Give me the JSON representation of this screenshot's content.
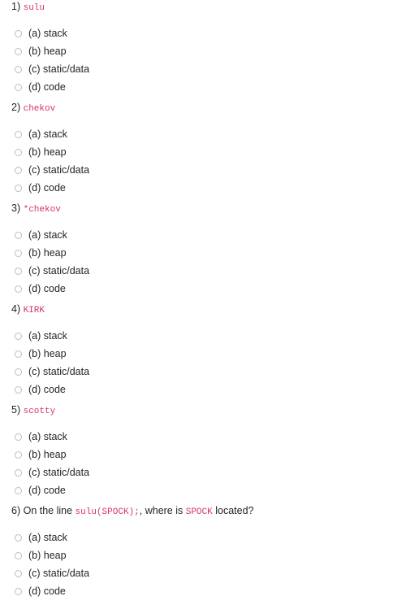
{
  "form": {
    "questions": [
      {
        "number": "1)",
        "text_parts": [
          {
            "type": "code",
            "value": "sulu"
          }
        ],
        "options": [
          {
            "label": "(a) stack"
          },
          {
            "label": "(b) heap"
          },
          {
            "label": "(c) static/data"
          },
          {
            "label": "(d) code"
          }
        ]
      },
      {
        "number": "2)",
        "text_parts": [
          {
            "type": "code",
            "value": "chekov"
          }
        ],
        "options": [
          {
            "label": "(a) stack"
          },
          {
            "label": "(b) heap"
          },
          {
            "label": "(c) static/data"
          },
          {
            "label": "(d) code"
          }
        ]
      },
      {
        "number": "3)",
        "text_parts": [
          {
            "type": "code",
            "value": "*chekov"
          }
        ],
        "options": [
          {
            "label": "(a) stack"
          },
          {
            "label": "(b) heap"
          },
          {
            "label": "(c) static/data"
          },
          {
            "label": "(d) code"
          }
        ]
      },
      {
        "number": "4)",
        "text_parts": [
          {
            "type": "code",
            "value": "KIRK"
          }
        ],
        "options": [
          {
            "label": "(a) stack"
          },
          {
            "label": "(b) heap"
          },
          {
            "label": "(c) static/data"
          },
          {
            "label": "(d) code"
          }
        ]
      },
      {
        "number": "5)",
        "text_parts": [
          {
            "type": "code",
            "value": "scotty"
          }
        ],
        "options": [
          {
            "label": "(a) stack"
          },
          {
            "label": "(b) heap"
          },
          {
            "label": "(c) static/data"
          },
          {
            "label": "(d) code"
          }
        ]
      },
      {
        "number": "6)",
        "text_parts": [
          {
            "type": "text",
            "value": "On the line "
          },
          {
            "type": "code",
            "value": "sulu(SPOCK);"
          },
          {
            "type": "text",
            "value": ", where is "
          },
          {
            "type": "code",
            "value": "SPOCK"
          },
          {
            "type": "text",
            "value": " located?"
          }
        ],
        "options": [
          {
            "label": "(a) stack"
          },
          {
            "label": "(b) heap"
          },
          {
            "label": "(c) static/data"
          },
          {
            "label": "(d) code"
          }
        ]
      }
    ]
  },
  "colors": {
    "code_text": "#d6336c",
    "body_text": "#212529",
    "radio_border": "#bdbdbd",
    "background": "#ffffff"
  },
  "icons": {
    "radio_unselected": "radio-unchecked-icon"
  }
}
